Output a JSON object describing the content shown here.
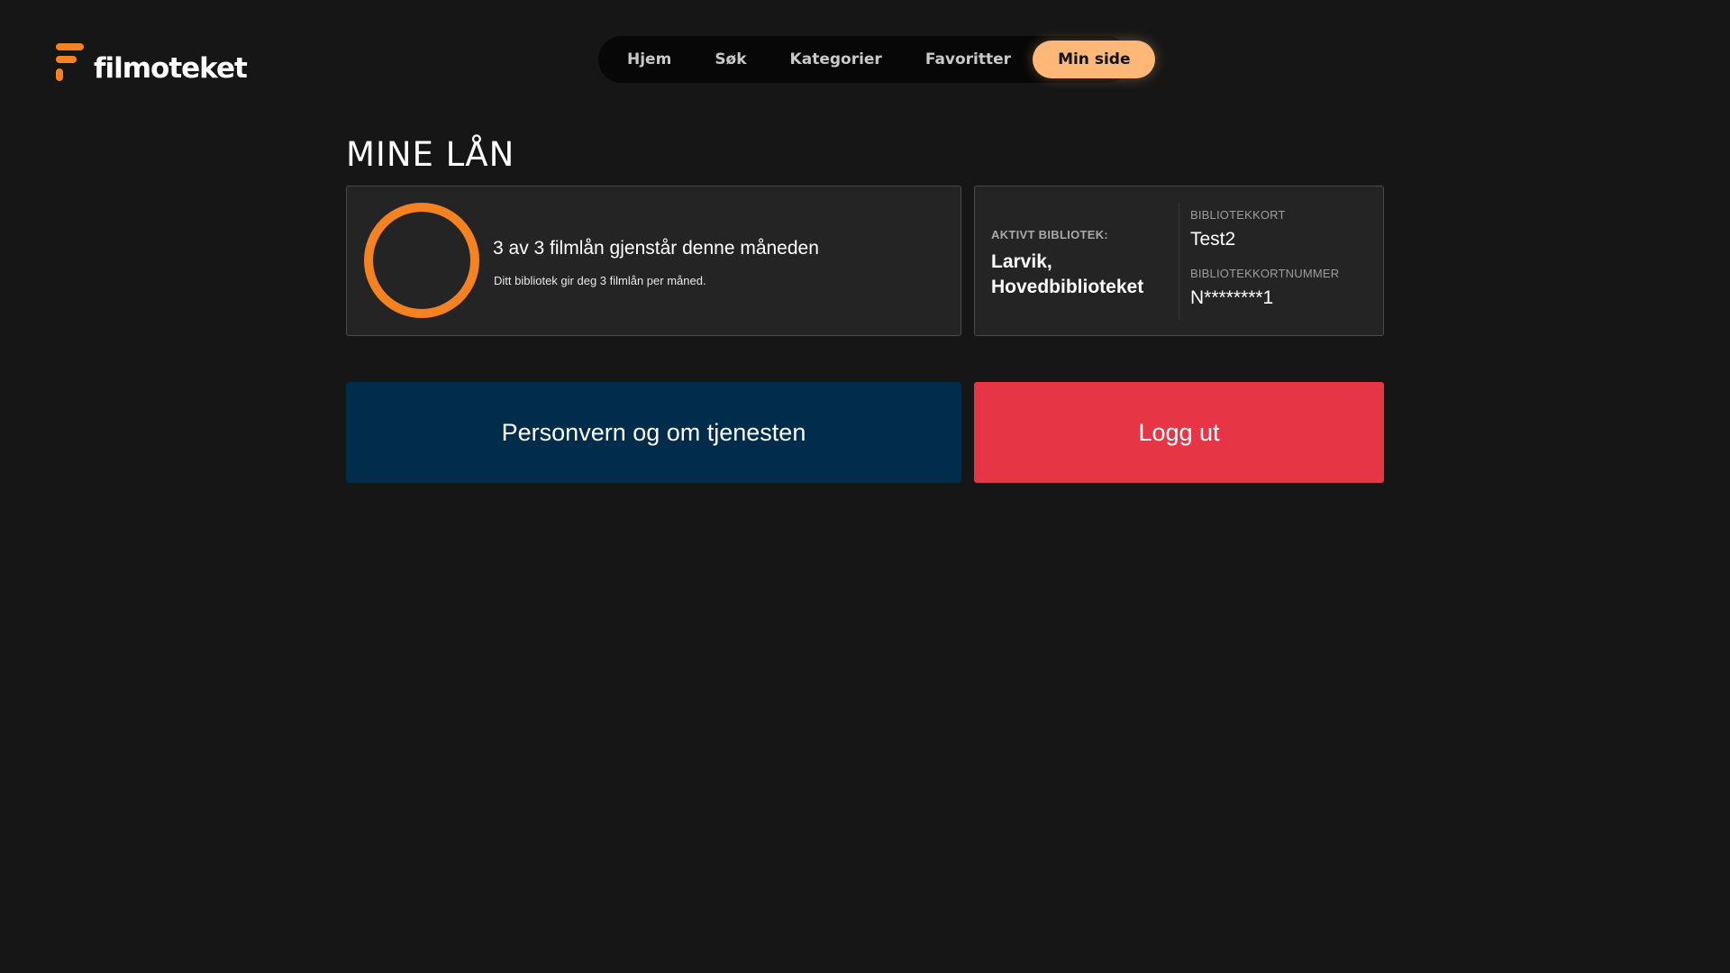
{
  "brand": {
    "name": "filmoteket",
    "accent": "#f58220"
  },
  "nav": {
    "items": [
      {
        "label": "Hjem"
      },
      {
        "label": "Søk"
      },
      {
        "label": "Kategorier"
      },
      {
        "label": "Favoritter"
      },
      {
        "label": "Min side"
      }
    ],
    "active": "Min side",
    "active_color": "#fdb777"
  },
  "page": {
    "title": "MINE LÅN"
  },
  "loans": {
    "remaining": 3,
    "total": 3,
    "remaining_fraction": 1.0,
    "title": "3 av 3 filmlån gjenstår denne måneden",
    "subtitle": "Ditt bibliotek gir deg 3 filmlån per måned.",
    "ring_color": "#f58220"
  },
  "library": {
    "active_label": "AKTIVT BIBLIOTEK:",
    "active_name": "Larvik, Hovedbiblioteket",
    "card_label": "BIBLIOTEKKORT",
    "card_value": "Test2",
    "card_number_label": "BIBLIOTEKKORTNUMMER",
    "card_number_value": "N********1"
  },
  "actions": {
    "privacy_label": "Personvern og om tjenesten",
    "privacy_color": "#012c4b",
    "logout_label": "Logg ut",
    "logout_color": "#e63646"
  }
}
